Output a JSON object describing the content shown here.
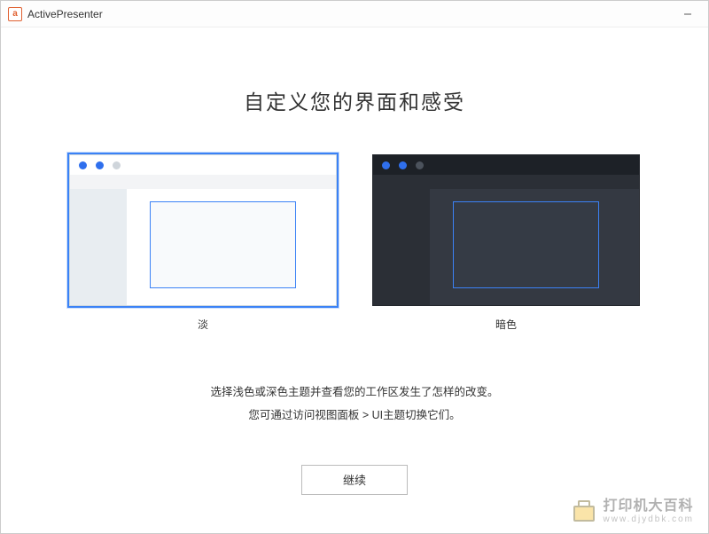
{
  "window": {
    "title": "ActivePresenter",
    "app_icon_letter": "a"
  },
  "heading": "自定义您的界面和感受",
  "themes": {
    "light_label": "淡",
    "dark_label": "暗色",
    "selected": "light"
  },
  "description": {
    "line1": "选择浅色或深色主题并查看您的工作区发生了怎样的改变。",
    "line2": "您可通过访问视图面板 > UI主题切换它们。"
  },
  "continue_label": "继续",
  "watermark": {
    "line1": "打印机大百科",
    "line2": "www.djydbk.com"
  }
}
